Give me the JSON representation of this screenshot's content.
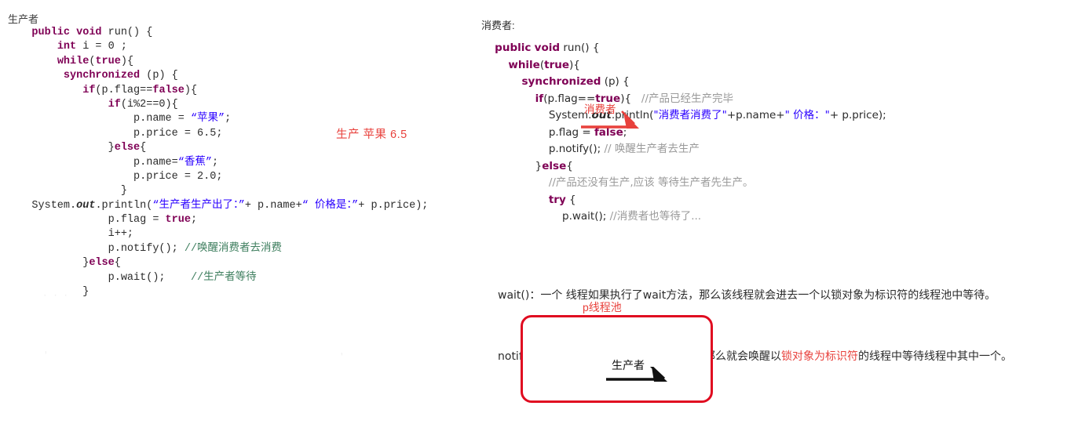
{
  "producer": {
    "title": "生产者",
    "code_lines": [
      {
        "indent": 4,
        "tokens": [
          {
            "t": "public",
            "c": "kw"
          },
          {
            "t": " ",
            "c": "plain"
          },
          {
            "t": "void",
            "c": "kw"
          },
          {
            "t": " run() {",
            "c": "plain"
          }
        ]
      },
      {
        "indent": 8,
        "tokens": [
          {
            "t": "int",
            "c": "kw"
          },
          {
            "t": " i = 0 ;",
            "c": "plain"
          }
        ]
      },
      {
        "indent": 8,
        "tokens": [
          {
            "t": "while",
            "c": "kw"
          },
          {
            "t": "(",
            "c": "plain"
          },
          {
            "t": "true",
            "c": "kw"
          },
          {
            "t": "){",
            "c": "plain"
          }
        ]
      },
      {
        "indent": 8,
        "tokens": [
          {
            "t": " ",
            "c": "plain"
          },
          {
            "t": "synchronized",
            "c": "kw"
          },
          {
            "t": " (p) {",
            "c": "plain"
          }
        ]
      },
      {
        "indent": 12,
        "tokens": [
          {
            "t": "if",
            "c": "kw"
          },
          {
            "t": "(p.flag==",
            "c": "plain"
          },
          {
            "t": "false",
            "c": "kw"
          },
          {
            "t": "){",
            "c": "plain"
          }
        ]
      },
      {
        "indent": 16,
        "tokens": [
          {
            "t": "if",
            "c": "kw"
          },
          {
            "t": "(i%2==0){",
            "c": "plain"
          }
        ]
      },
      {
        "indent": 20,
        "tokens": [
          {
            "t": "p.name = ",
            "c": "plain"
          },
          {
            "t": "“苹果”",
            "c": "str"
          },
          {
            "t": ";",
            "c": "plain"
          }
        ]
      },
      {
        "indent": 20,
        "tokens": [
          {
            "t": "p.price = 6.5;",
            "c": "plain"
          }
        ]
      },
      {
        "indent": 16,
        "tokens": [
          {
            "t": "}",
            "c": "plain"
          },
          {
            "t": "else",
            "c": "kw"
          },
          {
            "t": "{",
            "c": "plain"
          }
        ]
      },
      {
        "indent": 20,
        "tokens": [
          {
            "t": "p.name=",
            "c": "plain"
          },
          {
            "t": "“香蕉”",
            "c": "str"
          },
          {
            "t": ";",
            "c": "plain"
          }
        ]
      },
      {
        "indent": 20,
        "tokens": [
          {
            "t": "p.price = 2.0;",
            "c": "plain"
          }
        ]
      },
      {
        "indent": 18,
        "tokens": [
          {
            "t": "}",
            "c": "plain"
          }
        ]
      },
      {
        "indent": 4,
        "tokens": [
          {
            "t": "System.",
            "c": "plain"
          },
          {
            "t": "out",
            "c": "it"
          },
          {
            "t": ".println(",
            "c": "plain"
          },
          {
            "t": "“生产者生产出了：”",
            "c": "str"
          },
          {
            "t": "+ p.name+",
            "c": "plain"
          },
          {
            "t": "“ 价格是：”",
            "c": "str"
          },
          {
            "t": "+ p.price);",
            "c": "plain"
          }
        ]
      },
      {
        "indent": 16,
        "tokens": [
          {
            "t": "p.flag = ",
            "c": "plain"
          },
          {
            "t": "true",
            "c": "kw"
          },
          {
            "t": ";",
            "c": "plain"
          }
        ]
      },
      {
        "indent": 16,
        "tokens": [
          {
            "t": "i++;",
            "c": "plain"
          }
        ]
      },
      {
        "indent": 16,
        "tokens": [
          {
            "t": "p.notify(); ",
            "c": "plain"
          },
          {
            "t": "//唤醒消费者去消费",
            "c": "cmt-green"
          }
        ]
      },
      {
        "indent": 12,
        "tokens": [
          {
            "t": "}",
            "c": "plain"
          },
          {
            "t": "else",
            "c": "kw"
          },
          {
            "t": "{",
            "c": "plain"
          }
        ]
      },
      {
        "indent": 16,
        "tokens": [
          {
            "t": "p.wait();    ",
            "c": "plain"
          },
          {
            "t": "//生产者等待",
            "c": "cmt-green"
          }
        ]
      },
      {
        "indent": 12,
        "tokens": [
          {
            "t": "}",
            "c": "plain"
          }
        ]
      }
    ],
    "ellipsis_marker": "· · ·"
  },
  "consumer": {
    "title": "消费者:",
    "code_lines": [
      {
        "indent": 4,
        "tokens": [
          {
            "t": "public",
            "c": "kw"
          },
          {
            "t": " ",
            "c": "plain"
          },
          {
            "t": "void",
            "c": "kw"
          },
          {
            "t": " run() {",
            "c": "plain"
          }
        ]
      },
      {
        "indent": 8,
        "tokens": [
          {
            "t": "while",
            "c": "kw"
          },
          {
            "t": "(",
            "c": "plain"
          },
          {
            "t": "true",
            "c": "kw"
          },
          {
            "t": "){",
            "c": "plain"
          }
        ]
      },
      {
        "indent": 12,
        "tokens": [
          {
            "t": "synchronized",
            "c": "kw"
          },
          {
            "t": " (p) {",
            "c": "plain"
          }
        ]
      },
      {
        "indent": 16,
        "tokens": [
          {
            "t": "if",
            "c": "kw"
          },
          {
            "t": "(p.flag==",
            "c": "plain"
          },
          {
            "t": "true",
            "c": "kw"
          },
          {
            "t": "){   ",
            "c": "plain"
          },
          {
            "t": "//产品已经生产完毕",
            "c": "cmt-gray"
          }
        ]
      },
      {
        "indent": 20,
        "tokens": [
          {
            "t": "System.",
            "c": "plain"
          },
          {
            "t": "out",
            "c": "it"
          },
          {
            "t": ".println(",
            "c": "plain"
          },
          {
            "t": "\"消费者消费了\"",
            "c": "str"
          },
          {
            "t": "+p.name+",
            "c": "plain"
          },
          {
            "t": "\" 价格：\"",
            "c": "str"
          },
          {
            "t": "+ p.price);",
            "c": "plain"
          }
        ]
      },
      {
        "indent": 20,
        "tokens": [
          {
            "t": "p.flag = ",
            "c": "plain"
          },
          {
            "t": "false",
            "c": "kw"
          },
          {
            "t": ";",
            "c": "plain"
          }
        ]
      },
      {
        "indent": 20,
        "tokens": [
          {
            "t": "p.notify(); ",
            "c": "plain"
          },
          {
            "t": "// 唤醒生产者去生产",
            "c": "cmt-gray"
          }
        ]
      },
      {
        "indent": 16,
        "tokens": [
          {
            "t": "}",
            "c": "plain"
          },
          {
            "t": "else",
            "c": "kw"
          },
          {
            "t": "{",
            "c": "plain"
          }
        ]
      },
      {
        "indent": 20,
        "tokens": [
          {
            "t": "//产品还没有生产,应该 等待生产者先生产。",
            "c": "cmt-gray"
          }
        ]
      },
      {
        "indent": 20,
        "tokens": [
          {
            "t": "try",
            "c": "kw"
          },
          {
            "t": " {",
            "c": "plain"
          }
        ]
      },
      {
        "indent": 24,
        "tokens": [
          {
            "t": "p.wait(); ",
            "c": "plain"
          },
          {
            "t": "//消费者也等待了...",
            "c": "cmt-gray"
          }
        ]
      }
    ]
  },
  "annotations": {
    "produce_note": "生产 苹果 6.5",
    "consumer_arrow_label": "消费者",
    "arrow_color": "#e8413c"
  },
  "explanation": {
    "line1_prefix": "wait()：一个 线程如果执行了wait方法，那么该线程就会进去一个以锁对象为标识符的线程池中等待。",
    "line2_a": "notify()：如果一个线程执行notify方法 ，那么就会唤醒以",
    "line2_hl": "锁对象为标识符",
    "line2_b": "的线程中等待线程中其中一个。",
    "highlight_color": "#e8413c"
  },
  "pool_diagram": {
    "label": "p线程池",
    "inner_label": "生产者",
    "border_color": "#e00b20",
    "arrow_color": "#111111"
  }
}
